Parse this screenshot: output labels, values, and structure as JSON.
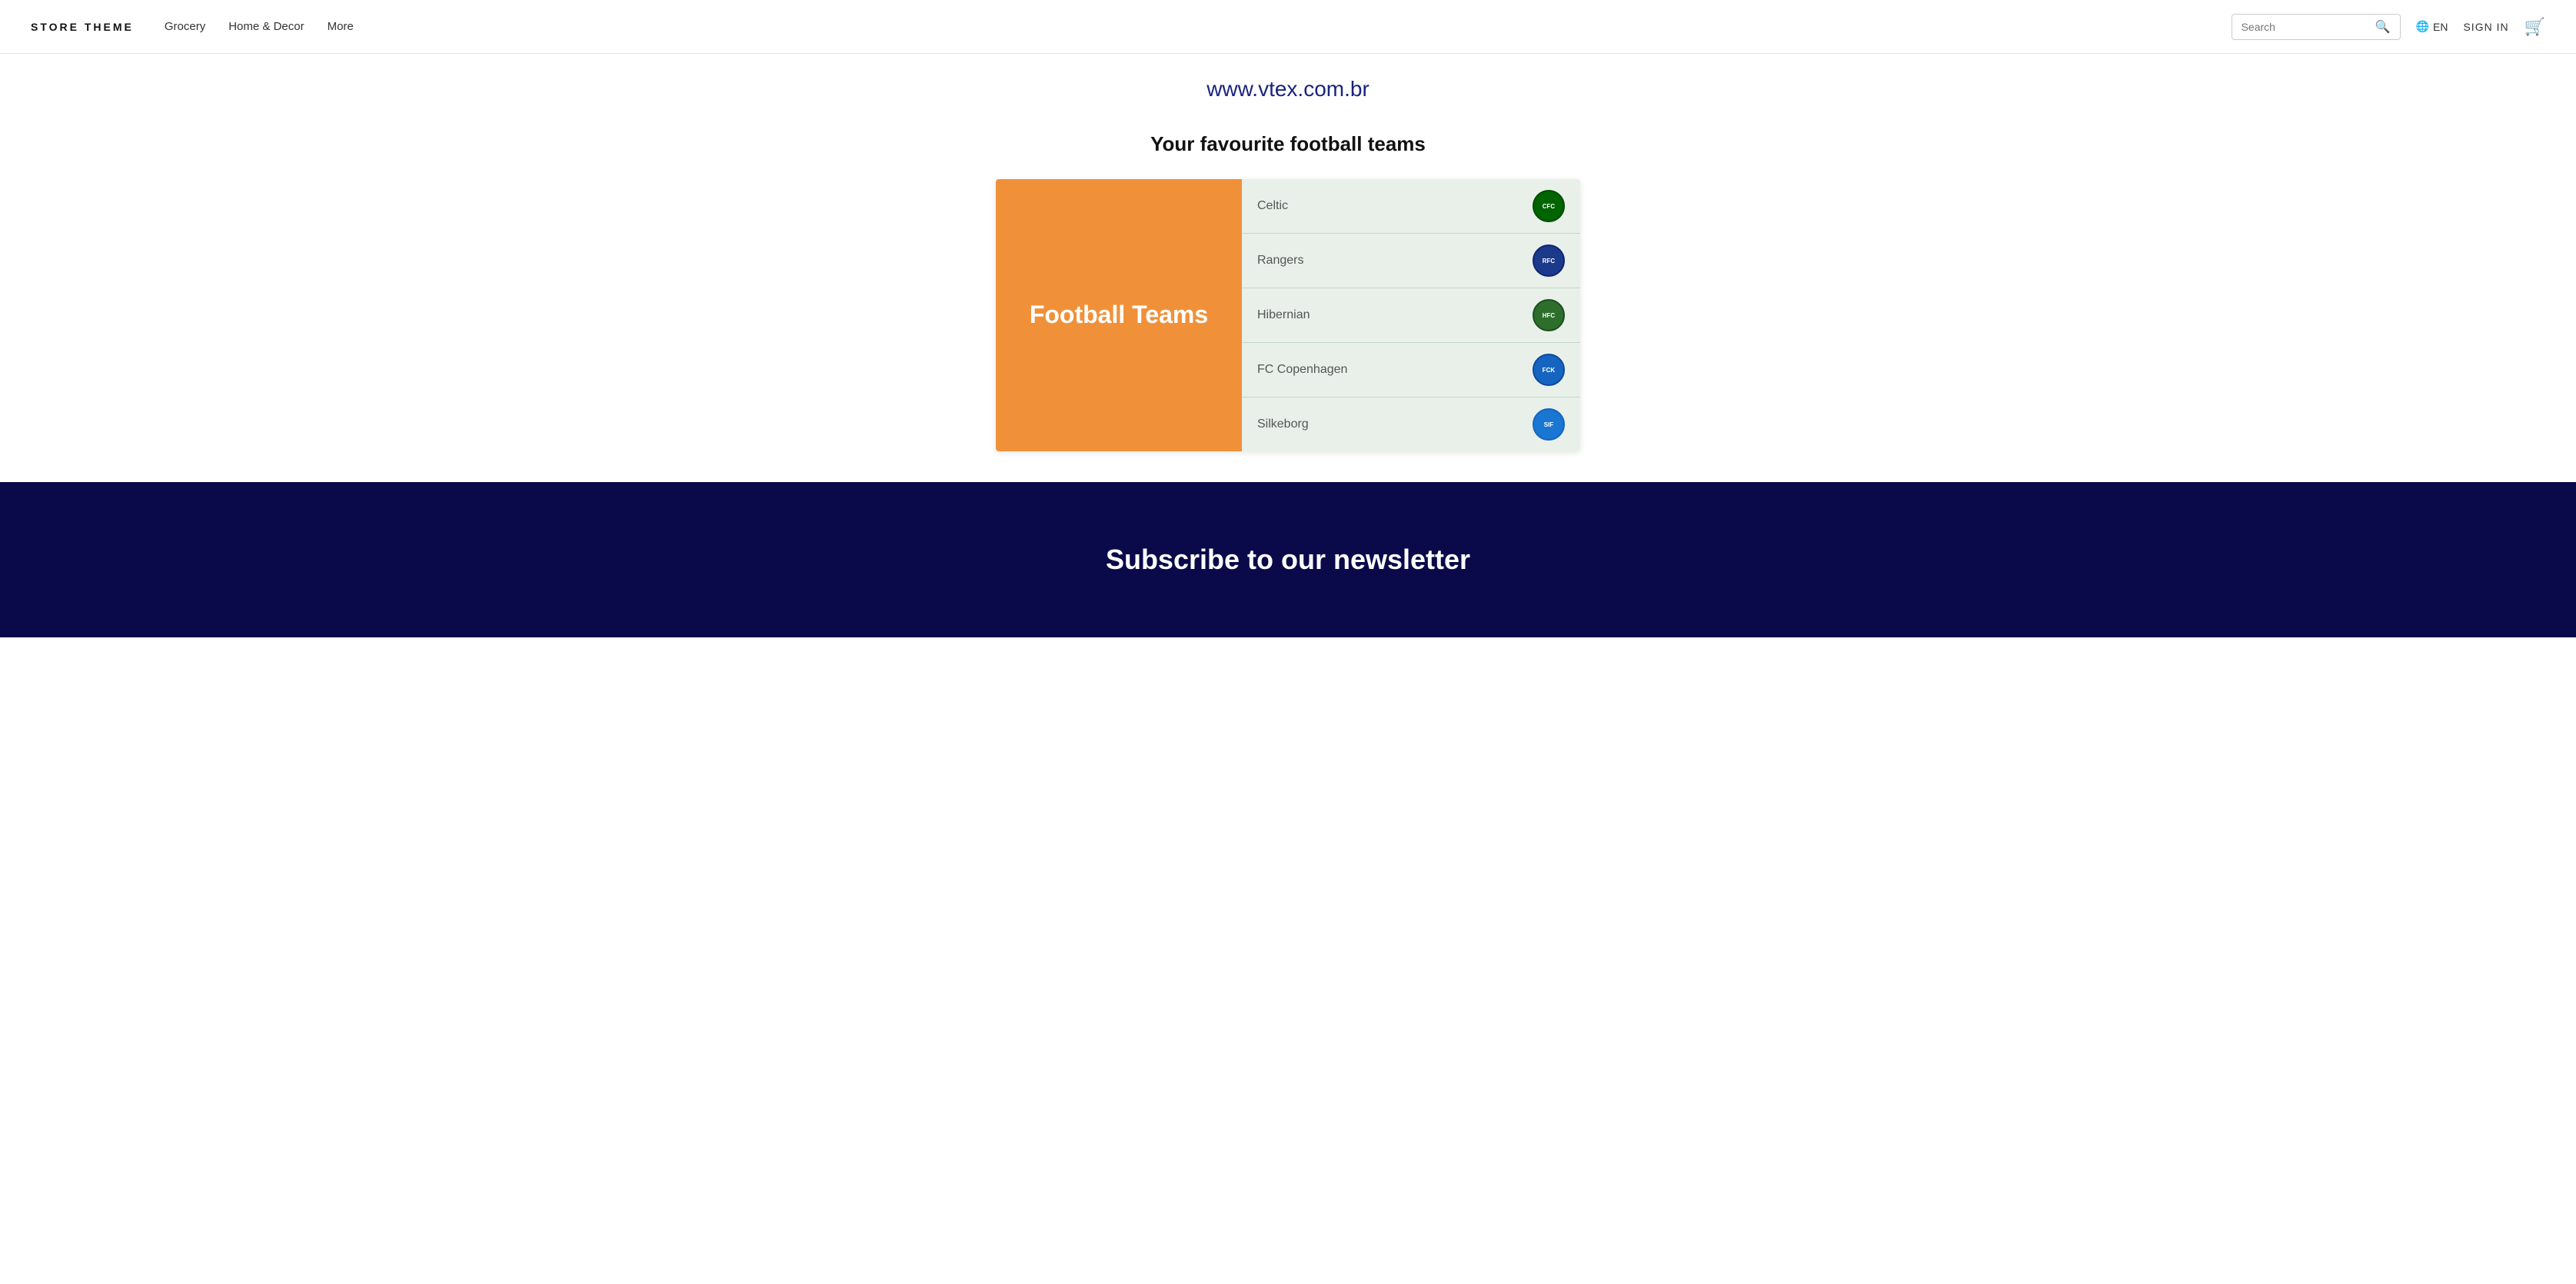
{
  "brand": {
    "name": "STORE THEME"
  },
  "nav": {
    "links": [
      {
        "id": "grocery",
        "label": "Grocery"
      },
      {
        "id": "home-decor",
        "label": "Home & Decor"
      },
      {
        "id": "more",
        "label": "More"
      }
    ],
    "search_placeholder": "Search",
    "lang_label": "EN",
    "sign_in_label": "SIGN IN"
  },
  "main": {
    "vtex_url": "www.vtex.com.br",
    "section_title": "Your favourite football teams",
    "football_widget_title": "Football Teams",
    "teams": [
      {
        "id": "celtic",
        "name": "Celtic",
        "logo_class": "logo-celtic",
        "logo_abbr": "CFC"
      },
      {
        "id": "rangers",
        "name": "Rangers",
        "logo_class": "logo-rangers",
        "logo_abbr": "RFC"
      },
      {
        "id": "hibernian",
        "name": "Hibernian",
        "logo_class": "logo-hibernian",
        "logo_abbr": "HFC"
      },
      {
        "id": "fc-copenhagen",
        "name": "FC Copenhagen",
        "logo_class": "logo-fccopenhagen",
        "logo_abbr": "FCK"
      },
      {
        "id": "silkeborg",
        "name": "Silkeborg",
        "logo_class": "logo-silkeborg",
        "logo_abbr": "SIF"
      }
    ]
  },
  "newsletter": {
    "title": "Subscribe to our newsletter"
  }
}
